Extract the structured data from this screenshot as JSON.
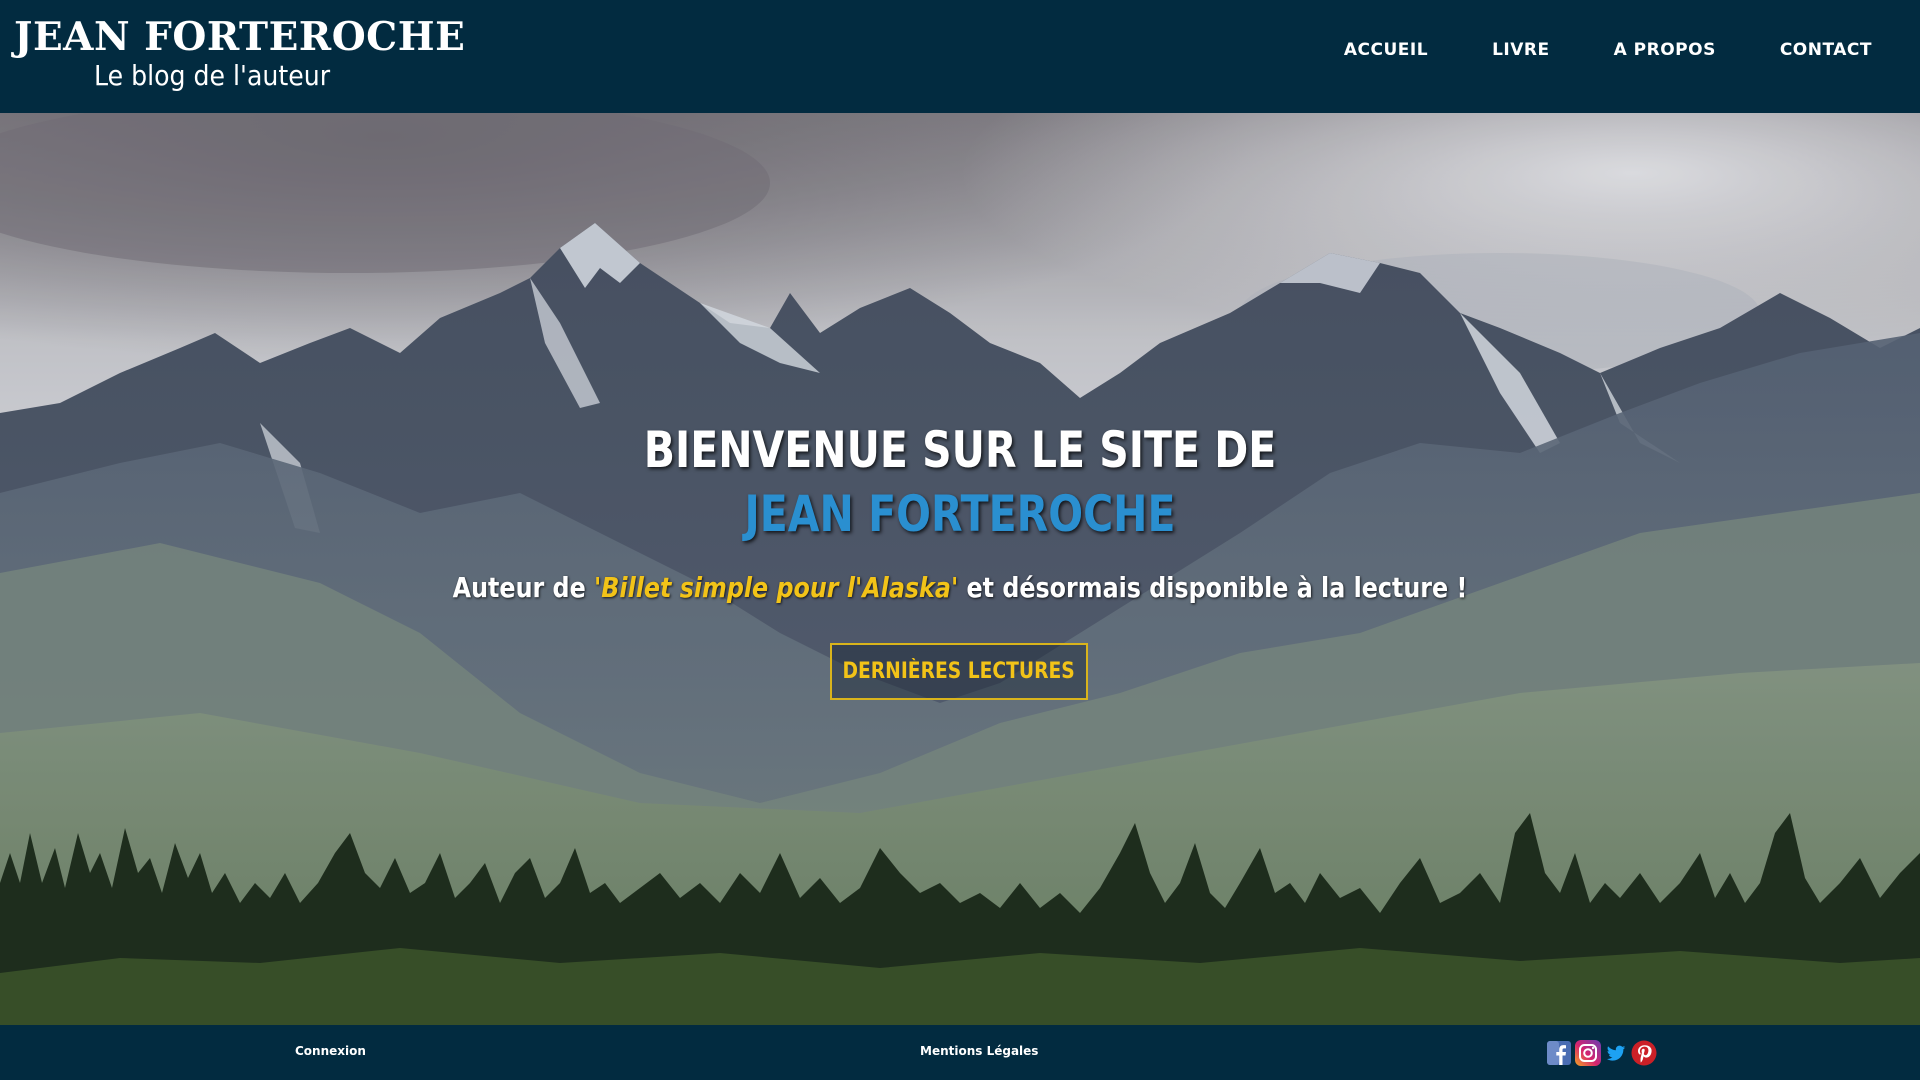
{
  "header": {
    "brand_title": "JEAN FORTEROCHE",
    "brand_subtitle": "Le blog de l'auteur",
    "nav": [
      {
        "label": "ACCUEIL"
      },
      {
        "label": "LIVRE"
      },
      {
        "label": "A PROPOS"
      },
      {
        "label": "CONTACT"
      }
    ]
  },
  "hero": {
    "title_prefix": "BIENVENUE SUR LE SITE DE",
    "title_accent": "JEAN FORTEROCHE",
    "subtitle_prefix": "Auteur de",
    "book_title": "'Billet simple pour l'Alaska'",
    "subtitle_suffix": "et désormais disponible à la lecture !",
    "cta_label": "DERNIÈRES LECTURES"
  },
  "footer": {
    "login_label": "Connexion",
    "legal_label": "Mentions Légales",
    "social": [
      {
        "name": "facebook-icon",
        "color": "#3b5998"
      },
      {
        "name": "instagram-icon",
        "color": "#c13584"
      },
      {
        "name": "twitter-icon",
        "color": "#1da1f2"
      },
      {
        "name": "pinterest-icon",
        "color": "#cb2027"
      }
    ]
  },
  "colors": {
    "navy": "#022b40",
    "accent_blue": "#2a8fd0",
    "accent_yellow": "#f2c318"
  }
}
